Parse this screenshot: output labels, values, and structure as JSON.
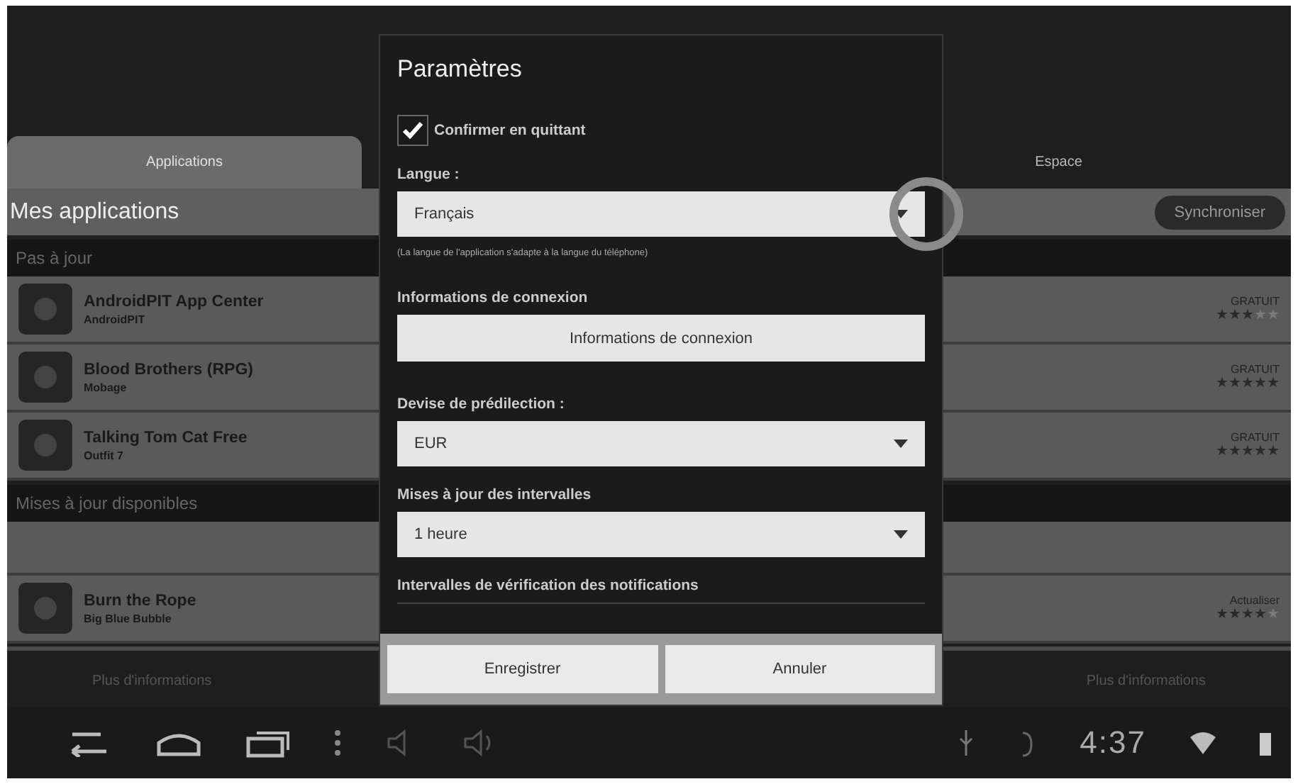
{
  "tabs": [
    {
      "label": "Applications",
      "selected": true
    },
    {
      "label": "Espace",
      "selected": false
    }
  ],
  "header": {
    "title": "Mes applications",
    "sync_button": "Synchroniser"
  },
  "sections": [
    {
      "title": "Pas à jour",
      "rows": [
        {
          "name": "AndroidPIT App Center",
          "developer": "AndroidPIT",
          "price": "GRATUIT",
          "stars": 3
        },
        {
          "name": "Blood Brothers (RPG)",
          "developer": "Mobage",
          "price": "GRATUIT",
          "stars": 5
        },
        {
          "name": "Talking Tom Cat Free",
          "developer": "Outfit 7",
          "price": "GRATUIT",
          "stars": 5
        }
      ]
    },
    {
      "title": "Mises à jour disponibles",
      "rows": [
        {
          "kind": "empty"
        },
        {
          "name": "Burn the Rope",
          "developer": "Big Blue Bubble",
          "price": "Actualiser",
          "stars": 4
        }
      ]
    }
  ],
  "footer": {
    "left": "Plus d'informations",
    "right": "Plus d'informations"
  },
  "dialog": {
    "title": "Paramètres",
    "items": [
      {
        "kind": "checkbox",
        "label": "Confirmer en quittant",
        "checked": true
      },
      {
        "kind": "dropdown",
        "label": "Langue :",
        "value": "Français",
        "hint": "(La langue de l'application s'adapte à la langue du téléphone)",
        "highlighted": true
      },
      {
        "kind": "button",
        "label": "Informations de connexion",
        "button": "Informations de connexion"
      },
      {
        "kind": "dropdown",
        "label": "Devise de prédilection :",
        "value": "EUR"
      },
      {
        "kind": "dropdown",
        "label": "Mises à jour des intervalles",
        "value": "1 heure"
      },
      {
        "kind": "heading",
        "label": "Intervalles de vérification des notifications"
      }
    ],
    "buttons": [
      "Enregistrer",
      "Annuler"
    ]
  },
  "status_bar": {
    "time": "4:37"
  }
}
